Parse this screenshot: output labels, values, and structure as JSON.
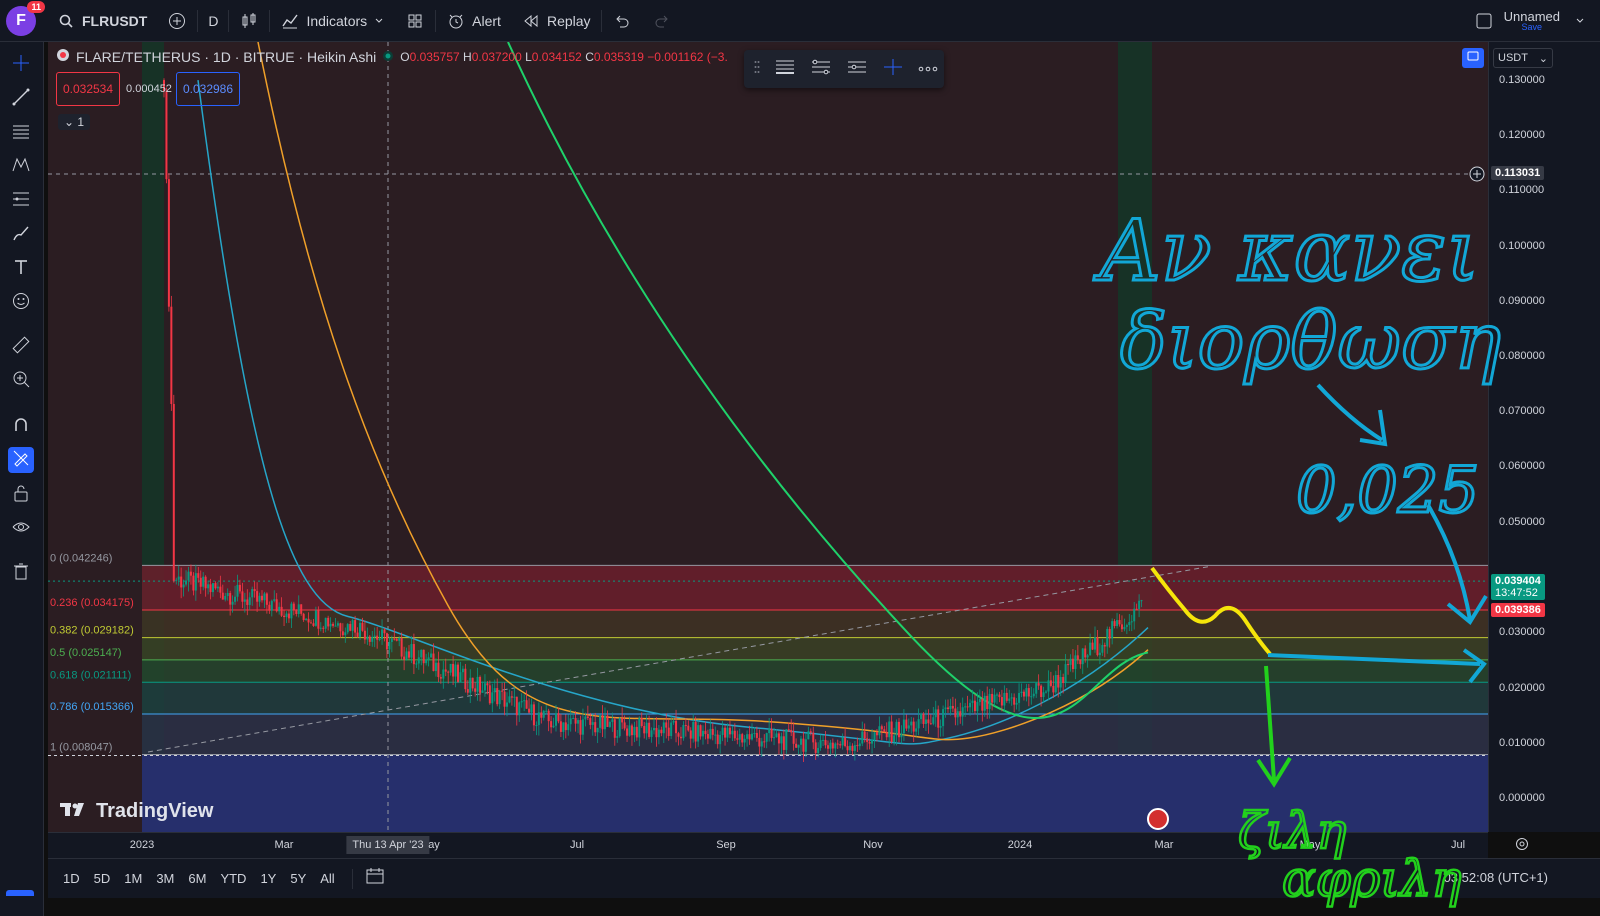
{
  "app": {
    "logo_letter": "F",
    "notifications": "11",
    "symbol": "FLRUSDT",
    "interval": "D",
    "indicators_label": "Indicators",
    "alert_label": "Alert",
    "replay_label": "Replay",
    "layout_name": "Unnamed",
    "save_label": "Save"
  },
  "legend": {
    "title": "FLARE/TETHERUS · 1D · BITRUE · Heikin Ashi",
    "o_label": "O",
    "o": "0.035757",
    "h_label": "H",
    "h": "0.037200",
    "l_label": "L",
    "l": "0.034152",
    "c_label": "C",
    "c": "0.035319",
    "chg": "−0.001162 (−3.",
    "sell_price": "0.032534",
    "spread": "0.000452",
    "buy_price": "0.032986",
    "collapse_count": "1"
  },
  "price_axis": {
    "currency": "USDT",
    "ticks": [
      "0.130000",
      "0.120000",
      "0.110000",
      "0.100000",
      "0.090000",
      "0.080000",
      "0.070000",
      "0.060000",
      "0.050000",
      "0.030000",
      "0.020000",
      "0.010000",
      "0.000000"
    ],
    "crosshair_price": "0.113031",
    "last_price": "0.039404",
    "countdown": "13:47:52",
    "prev_close": "0.039386"
  },
  "fib_levels": [
    {
      "label": "0 (0.042246)",
      "color": "#9598a1"
    },
    {
      "label": "0.236 (0.034175)",
      "color": "#f23645"
    },
    {
      "label": "0.382 (0.029182)",
      "color": "#c0ca33"
    },
    {
      "label": "0.5 (0.025147)",
      "color": "#4caf50"
    },
    {
      "label": "0.618 (0.021111)",
      "color": "#089981"
    },
    {
      "label": "0.786 (0.015366)",
      "color": "#42a5f5"
    },
    {
      "label": "1 (0.008047)",
      "color": "#9598a1"
    }
  ],
  "time_axis": {
    "ticks": [
      "2023",
      "Mar",
      "Jul",
      "Sep",
      "Nov",
      "2024",
      "Mar",
      "May",
      "Jul"
    ],
    "crosshair_date": "Thu 13 Apr '23",
    "crosshair_suffix": "ay"
  },
  "bottom": {
    "ranges": [
      "1D",
      "5D",
      "1M",
      "3M",
      "6M",
      "YTD",
      "1Y",
      "5Y",
      "All"
    ],
    "clock": "03:52:08 (UTC+1)"
  },
  "watermark": "TradingView",
  "annotations": {
    "blue_line1": "Αν κανει",
    "blue_line2": "διορθωση",
    "blue_target": "0,025",
    "green_line1": "ζιλη",
    "green_line2": "αφριλη"
  },
  "colors": {
    "bg": "#131722",
    "up": "#089981",
    "down": "#f23645",
    "accent": "#2962ff",
    "ink_blue": "#12a7d6",
    "ink_yellow": "#f5e50a",
    "ink_green": "#22d11c"
  }
}
